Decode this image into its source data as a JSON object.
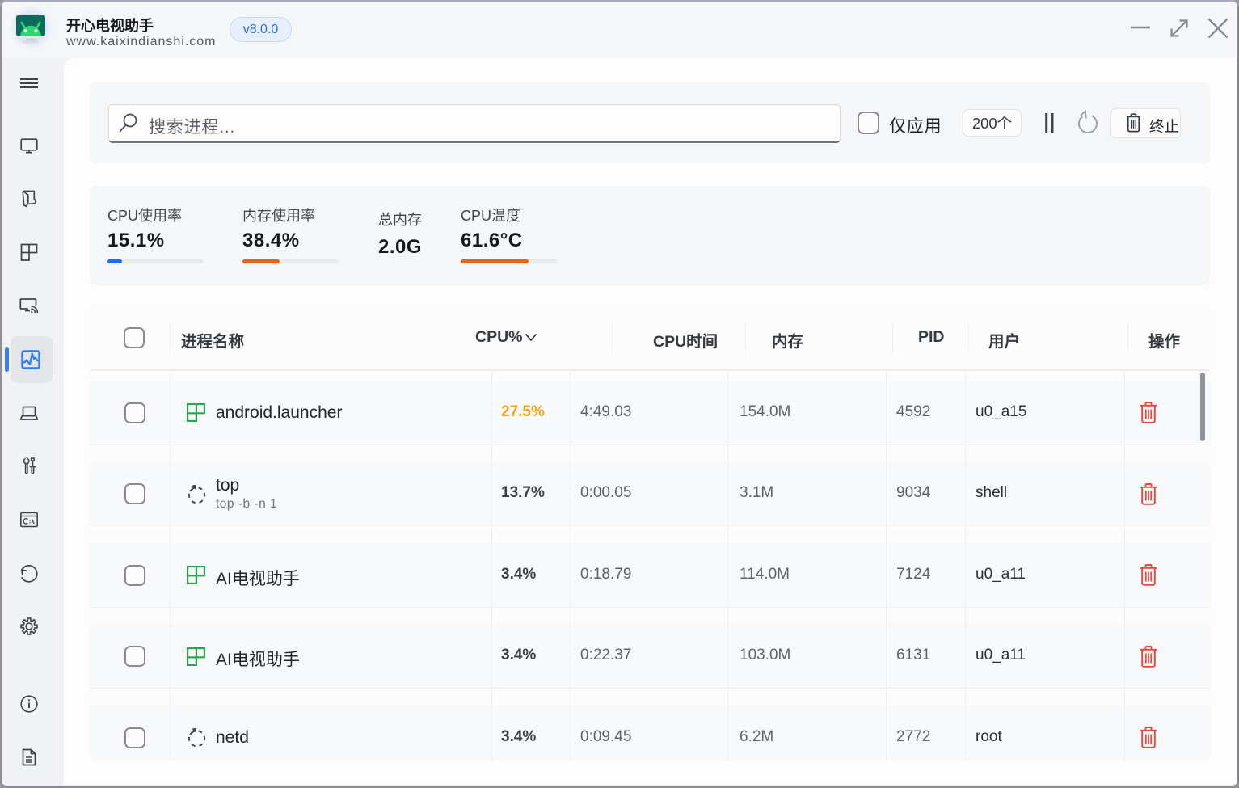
{
  "window": {
    "title": "开心电视助手",
    "subtitle": "www.kaixindianshi.com",
    "version_badge": "v8.0.0"
  },
  "sidebar": {
    "items": [
      {
        "name": "menu"
      },
      {
        "name": "display"
      },
      {
        "name": "apps"
      },
      {
        "name": "layout"
      },
      {
        "name": "screencast"
      },
      {
        "name": "task-monitor",
        "selected": true
      },
      {
        "name": "device"
      },
      {
        "name": "tools"
      },
      {
        "name": "terminal"
      },
      {
        "name": "history"
      },
      {
        "name": "settings"
      },
      {
        "name": "about"
      },
      {
        "name": "logs"
      }
    ],
    "accent_color": "#3b7df0"
  },
  "toolbar": {
    "search_placeholder": "搜索进程...",
    "apps_only_label": "仅应用",
    "count_badge": "200个",
    "terminate_label": "终止"
  },
  "stats": {
    "cards": [
      {
        "label": "CPU使用率",
        "value": "15.1%",
        "percent": 15.1,
        "color": "#1b6ef3"
      },
      {
        "label": "内存使用率",
        "value": "38.4%",
        "percent": 38.4,
        "color": "#e8650f"
      },
      {
        "label": "总内存",
        "value": "2.0G"
      },
      {
        "label": "CPU温度",
        "value": "61.6°C",
        "percent": 61.6,
        "bar_percent": 70.5,
        "color": "#e8650f"
      }
    ]
  },
  "table": {
    "headers": {
      "name": "进程名称",
      "cpu": "CPU%",
      "time": "CPU时间",
      "mem": "内存",
      "pid": "PID",
      "user": "用户",
      "actions": "操作"
    },
    "rows": [
      {
        "icon": "app",
        "name": "android.launcher",
        "sub": "",
        "cpu": "27.5%",
        "cpu_color": "#f0a51a",
        "time": "4:49.03",
        "mem": "154.0M",
        "pid": "4592",
        "user": "u0_a15"
      },
      {
        "icon": "proc",
        "name": "top",
        "sub": "top -b -n 1",
        "cpu": "13.7%",
        "cpu_color": "#3c4147",
        "time": "0:00.05",
        "mem": "3.1M",
        "pid": "9034",
        "user": "shell"
      },
      {
        "icon": "app",
        "name": "AI电视助手",
        "sub": "",
        "cpu": "3.4%",
        "cpu_color": "#3c4147",
        "time": "0:18.79",
        "mem": "114.0M",
        "pid": "7124",
        "user": "u0_a11"
      },
      {
        "icon": "app",
        "name": "AI电视助手",
        "sub": "",
        "cpu": "3.4%",
        "cpu_color": "#3c4147",
        "time": "0:22.37",
        "mem": "103.0M",
        "pid": "6131",
        "user": "u0_a11"
      },
      {
        "icon": "proc",
        "name": "netd",
        "sub": "",
        "cpu": "3.4%",
        "cpu_color": "#3c4147",
        "time": "0:09.45",
        "mem": "6.2M",
        "pid": "2772",
        "user": "root"
      }
    ]
  },
  "colors": {
    "accent_blue": "#1b6ef3",
    "accent_orange": "#e8650f",
    "cpu_highlight": "#f0a51a",
    "danger_red": "#ef4444",
    "app_icon_green": "#2ba44e"
  }
}
